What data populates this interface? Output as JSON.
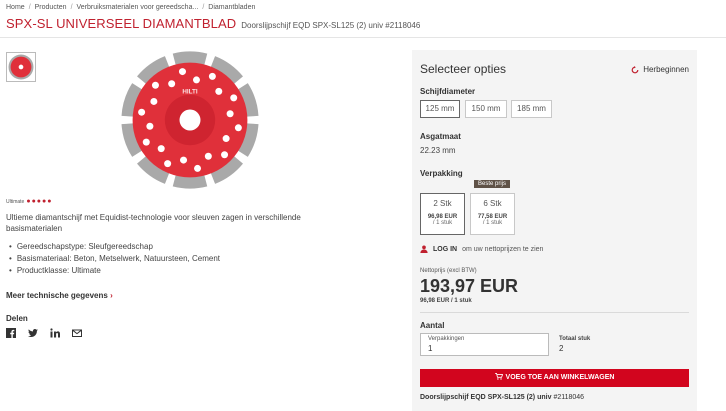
{
  "breadcrumbs": [
    "Home",
    "Producten",
    "Verbruiksmaterialen voor gereedscha...",
    "Diamantbladen"
  ],
  "product": {
    "title": "SPX-SL UNIVERSEEL DIAMANTBLAD",
    "subtitle": "Doorslijpschijf EQD SPX-SL125 (2) univ #2118046",
    "rating_label": "Ultimate",
    "rating_value": 5,
    "rating_dots": "●●●●●",
    "description": "Ultieme diamantschijf met Equidist-technologie voor sleuven zagen in verschillende basismaterialen",
    "features": [
      "Gereedschapstype: Sleufgereedschap",
      "Basismateriaal: Beton, Metselwerk, Natuursteen, Cement",
      "Productklasse: Ultimate"
    ],
    "more_details": "Meer technische gegevens",
    "more_arrow": "›",
    "share_label": "Delen",
    "share_icons": [
      "facebook-icon",
      "twitter-icon",
      "linkedin-icon",
      "email-icon"
    ]
  },
  "options": {
    "title": "Selecteer opties",
    "reset": "Herbeginnen",
    "diameter_label": "Schijfdiameter",
    "diameters": [
      "125 mm",
      "150 mm",
      "185 mm"
    ],
    "selected_diameter": "125 mm",
    "arbor_label": "Asgatmaat",
    "arbor_value": "22.23 mm",
    "packaging_label": "Verpakking",
    "packs": [
      {
        "qty": "2 Stk",
        "price": "96,98 EUR",
        "unit": "/ 1 stuk"
      },
      {
        "qty": "6 Stk",
        "price": "77,58 EUR",
        "unit": "/ 1 stuk"
      }
    ],
    "best_price_badge": "Beste prijs",
    "login_link": "LOG IN",
    "login_text": "om uw nettoprijzen te zien",
    "net_price_label": "Nettoprijs (excl BTW)",
    "net_price": "193,97 EUR",
    "unit_price": "96,98 EUR / 1 stuk",
    "quantity_label": "Aantal",
    "packages_label": "Verpakkingen",
    "packages_value": "1",
    "total_label": "Totaal stuk",
    "total_value": "2",
    "cart_button": "VOEG TOE AAN WINKELWAGEN",
    "bottom_name": "Doorslijpschijf EQD SPX-SL125 (2) univ",
    "bottom_sku": "#2118046"
  },
  "colors": {
    "brand": "#d2051e",
    "blade": "#e0303a",
    "segment": "#a9a9a9",
    "panel": "#f4f4f4"
  }
}
